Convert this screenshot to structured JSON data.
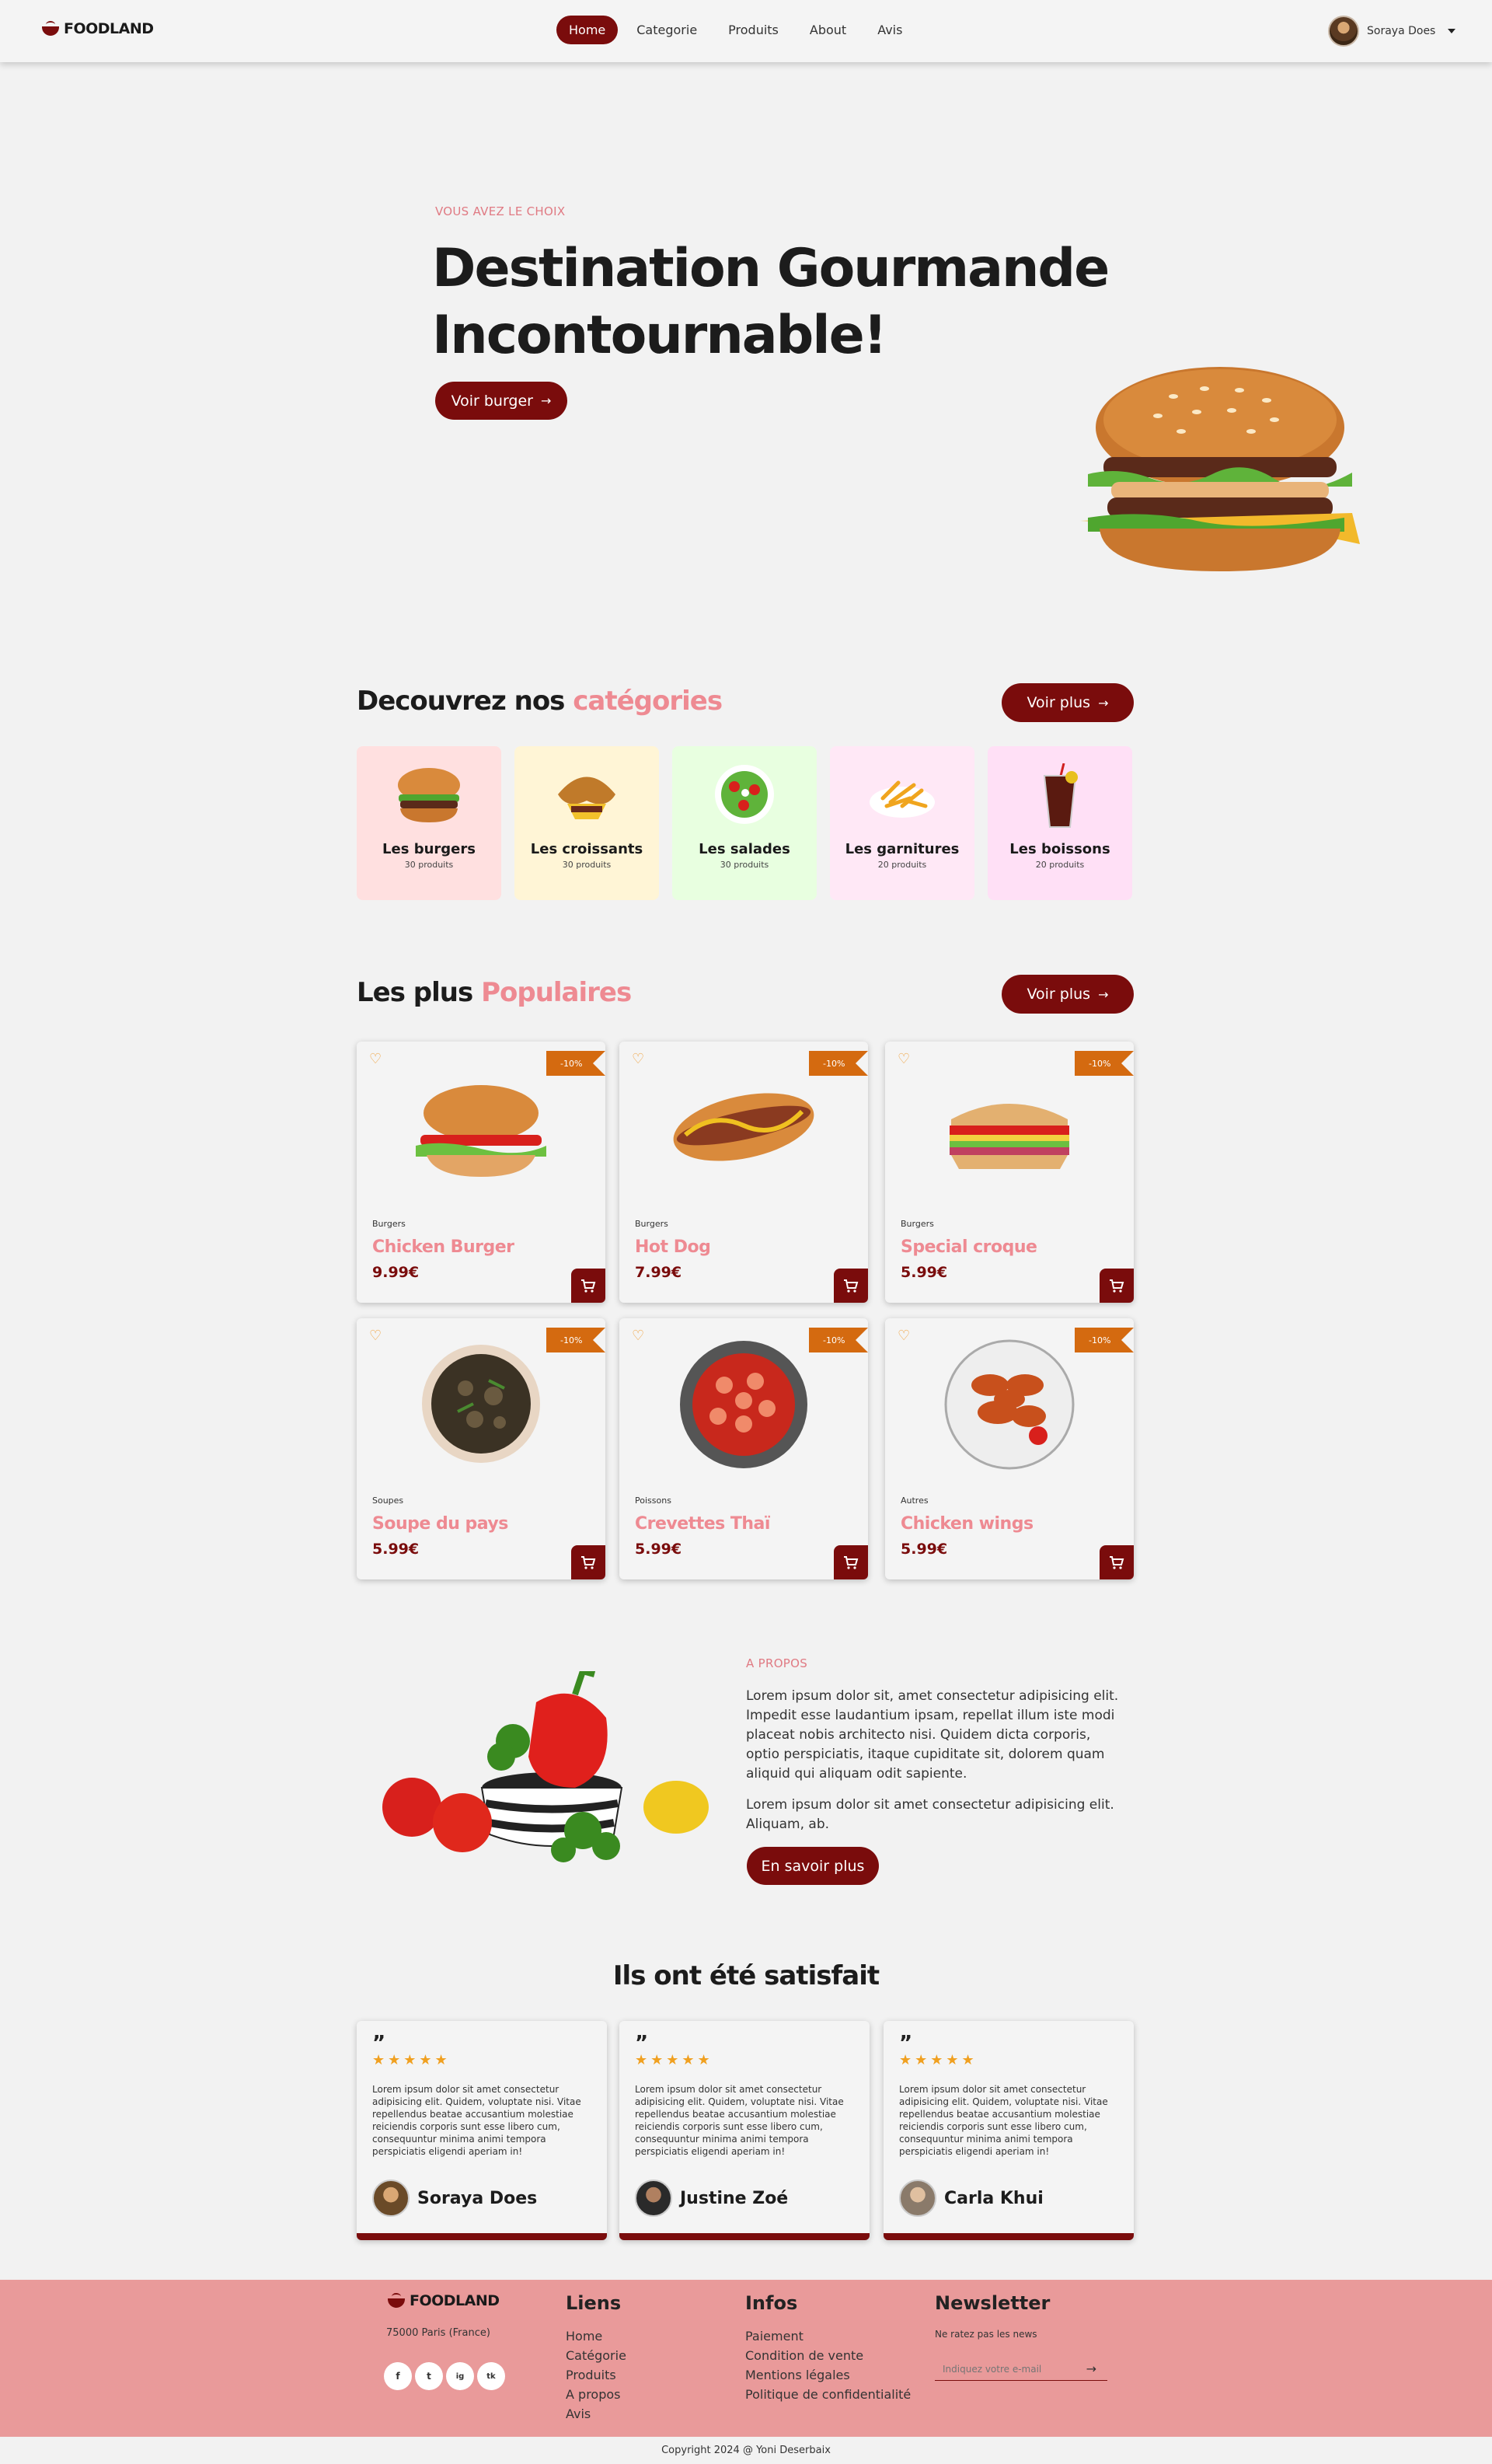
{
  "brand": {
    "name": "FOODLAND",
    "accent": "#7a0c0c",
    "pink": "#ee8a92",
    "orange": "#d46a10"
  },
  "nav": {
    "links": [
      "Home",
      "Categorie",
      "Produits",
      "About",
      "Avis"
    ],
    "active": "Home",
    "user_name": "Soraya Does"
  },
  "hero": {
    "eyebrow": "VOUS AVEZ LE CHOIX",
    "title_line1": "Destination Gourmande",
    "title_line2": "Incontournable!",
    "button": "Voir burger"
  },
  "categories": {
    "title_main": "Decouvrez nos ",
    "title_accent": "catégories",
    "button": "Voir plus",
    "items": [
      {
        "name": "Les burgers",
        "count": "30 produits",
        "bg": "#ffe0e0"
      },
      {
        "name": "Les croissants",
        "count": "30 produits",
        "bg": "#fff5d6"
      },
      {
        "name": "Les salades",
        "count": "30 produits",
        "bg": "#e8ffe0"
      },
      {
        "name": "Les garnitures",
        "count": "20 produits",
        "bg": "#ffe8f6"
      },
      {
        "name": "Les boissons",
        "count": "20 produits",
        "bg": "#ffe0f6"
      }
    ]
  },
  "popular": {
    "title_main": "Les plus ",
    "title_accent": "Populaires",
    "button": "Voir plus",
    "products": [
      {
        "category": "Burgers",
        "name": "Chicken Burger",
        "price": "9.99€",
        "discount": "-10%"
      },
      {
        "category": "Burgers",
        "name": "Hot Dog",
        "price": "7.99€",
        "discount": "-10%"
      },
      {
        "category": "Burgers",
        "name": "Special croque",
        "price": "5.99€",
        "discount": "-10%"
      },
      {
        "category": "Soupes",
        "name": "Soupe du pays",
        "price": "5.99€",
        "discount": "-10%"
      },
      {
        "category": "Poissons",
        "name": "Crevettes Thaï",
        "price": "5.99€",
        "discount": "-10%"
      },
      {
        "category": "Autres",
        "name": "Chicken wings",
        "price": "5.99€",
        "discount": "-10%"
      }
    ]
  },
  "about": {
    "eyebrow": "A PROPOS",
    "p1": "Lorem ipsum dolor sit, amet consectetur adipisicing elit. Impedit esse laudantium ipsam, repellat illum iste modi placeat nobis architecto nisi. Quidem dicta corporis, optio perspiciatis, itaque cupiditate sit, dolorem quam aliquid qui aliquam odit sapiente.",
    "p2": "Lorem ipsum dolor sit amet consectetur adipisicing elit. Aliquam, ab.",
    "button": "En savoir plus"
  },
  "testimonials": {
    "title": "Ils ont été satisfait",
    "quote_mark": "”",
    "stars": "★★★★★",
    "items": [
      {
        "name": "Soraya Does",
        "text": "Lorem ipsum dolor sit amet consectetur adipisicing elit. Quidem, voluptate nisi. Vitae repellendus beatae accusantium molestiae reiciendis corporis sunt esse libero cum, consequuntur minima animi tempora perspiciatis eligendi aperiam in!"
      },
      {
        "name": "Justine Zoé",
        "text": "Lorem ipsum dolor sit amet consectetur adipisicing elit. Quidem, voluptate nisi. Vitae repellendus beatae accusantium molestiae reiciendis corporis sunt esse libero cum, consequuntur minima animi tempora perspiciatis eligendi aperiam in!"
      },
      {
        "name": "Carla Khui",
        "text": "Lorem ipsum dolor sit amet consectetur adipisicing elit. Quidem, voluptate nisi. Vitae repellendus beatae accusantium molestiae reiciendis corporis sunt esse libero cum, consequuntur minima animi tempora perspiciatis eligendi aperiam in!"
      }
    ]
  },
  "footer": {
    "address": "75000 Paris (France)",
    "social": [
      "f",
      "t",
      "ig",
      "tk"
    ],
    "links_title": "Liens",
    "links": [
      "Home",
      "Catégorie",
      "Produits",
      "A propos",
      "Avis"
    ],
    "infos_title": "Infos",
    "infos": [
      "Paiement",
      "Condition de vente",
      "Mentions légales",
      "Politique de confidentialité"
    ],
    "newsletter_title": "Newsletter",
    "newsletter_sub": "Ne ratez pas les news",
    "newsletter_placeholder": "Indiquez votre e-mail",
    "copyright": "Copyright 2024 @ Yoni Deserbaix"
  }
}
